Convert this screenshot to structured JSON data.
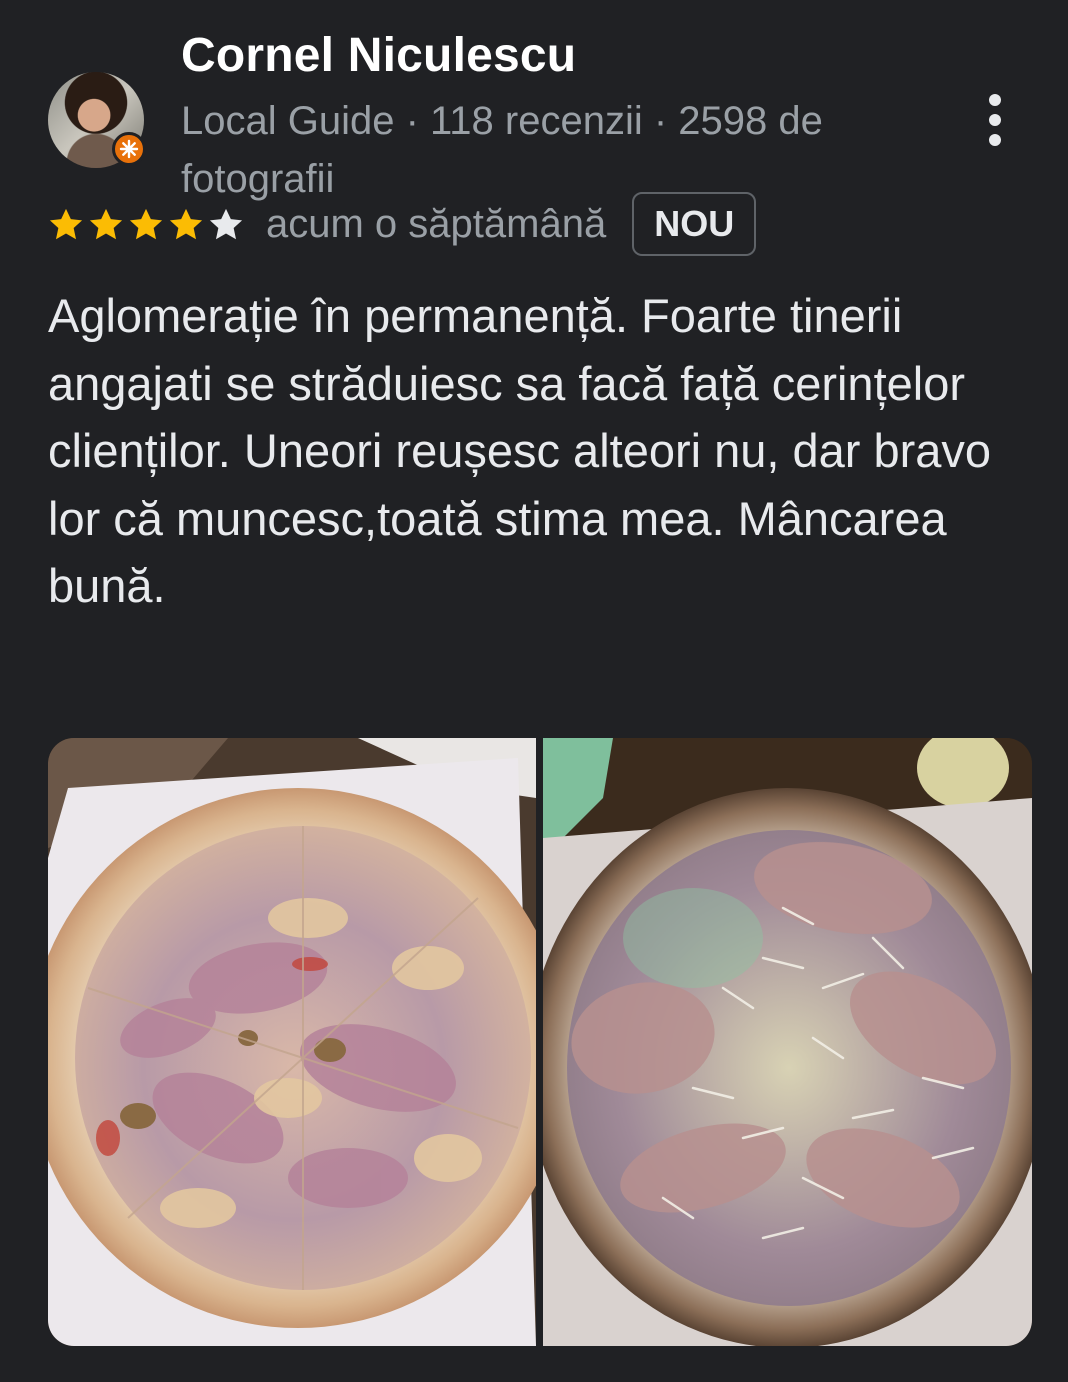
{
  "reviewer": {
    "name": "Cornel Niculescu",
    "meta": "Local Guide · 118 recenzii · 2598 de fotografii"
  },
  "rating": {
    "stars": 4,
    "max_stars": 5,
    "star_color": "#fbbc04",
    "empty_star_color": "#e8eaed"
  },
  "review": {
    "time": "acum o săptămână",
    "badge": "NOU",
    "text": "Aglomerație în permanență. Foarte tinerii angajati se străduiesc sa facă față cerințelor clienților. Uneori reușesc alteori nu, dar bravo lor că muncesc,toată stima mea. Mâncarea bună."
  },
  "photos": [
    {
      "name": "review-photo-pizza-ham"
    },
    {
      "name": "review-photo-pizza-prosciutto"
    }
  ],
  "icons": {
    "menu": "more-vert-icon",
    "guide_badge": "local-guide-badge-icon"
  }
}
